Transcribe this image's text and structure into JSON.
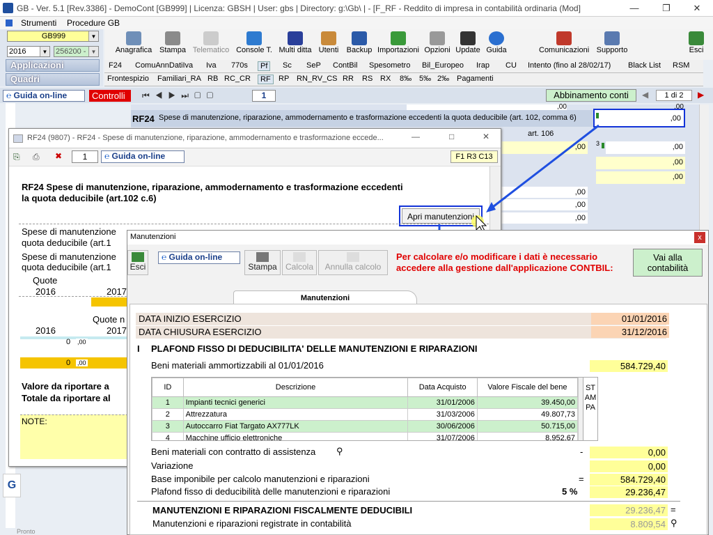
{
  "titlebar": {
    "title": "GB - Ver. 5.1 [Rev.3386] - DemoCont [GB999]   | Licenza: GBSH | User: gbs | Directory: g:\\Gb\\ | - [F_RF - Reddito di impresa in contabilità ordinaria (Mod]"
  },
  "menu": {
    "items": [
      "Strumenti",
      "Procedure GB"
    ]
  },
  "left": {
    "company": "GB999",
    "year": "2016",
    "code": "256200 -",
    "applicazioni": "Applicazioni",
    "quadri": "Quadri"
  },
  "toolbar": {
    "buttons": [
      "Anagrafica",
      "Stampa",
      "Telematico",
      "Console T.",
      "Multi ditta",
      "Utenti",
      "Backup",
      "Importazioni",
      "Opzioni",
      "Update",
      "Guida",
      "Comunicazioni",
      "Supporto",
      "Esci"
    ]
  },
  "tabs1": [
    "F24",
    "ComuAnnDatiIva",
    "Iva",
    "770s",
    "Pf",
    "Sc",
    "SeP",
    "ContBil",
    "Spesometro",
    "Bil_Europeo",
    "Irap",
    "CU",
    "Intento (fino al 28/02/17)",
    "Black List",
    "RSM"
  ],
  "tabs2": [
    "Frontespizio",
    "Familiari_RA",
    "RB",
    "RC_CR",
    "RF",
    "RP",
    "RN_RV_CS",
    "RR",
    "RS",
    "RX",
    "8‰",
    "5‰",
    "2‰",
    "Pagamenti"
  ],
  "navrow": {
    "guida": "Guida on-line",
    "controlli": "Controlli",
    "page": "1",
    "abbinamento": "Abbinamento conti",
    "page_of": "1 di 2"
  },
  "bg": {
    "rf24_code": "RF24",
    "rf24_desc": "Spese di manutenzione, riparazione, ammodernamento e trasformazione eccedenti la quota deducibile (art. 102, comma 6)",
    "rf24_val": ",00",
    "art106": "art. 106",
    "vals": [
      ",00",
      ",00",
      ",00",
      ",00",
      ",00",
      ",00",
      ",00"
    ],
    "small_nums": [
      "3",
      "2",
      "8"
    ],
    "top_vals": [
      ",00",
      ",00"
    ]
  },
  "win1": {
    "title": "RF24 (9807) - RF24 - Spese di manutenzione, riparazione, ammodernamento e trasformazione eccede...",
    "page": "1",
    "guida": "Guida on-line",
    "ref": "F1 R3 C13",
    "heading1": "RF24 Spese di manutenzione, riparazione, ammodernamento e trasformazione eccedenti",
    "heading2": "la quota deducibile (art.102 c.6)",
    "button": "Apri manutenzioni",
    "l1": "Spese di manutenzione",
    "l1b": "quota deducibile (art.1",
    "l2": "Spese di manutenzione",
    "l2b": "quota deducibile (art.1",
    "quote": "Quote",
    "y2016": "2016",
    "y2017": "2017",
    "quote2": "Quote n",
    "y2016b": "2016",
    "y2017b": "2017",
    "v0": "0",
    "v00": ",00",
    "v0b": "0",
    "v00b": ",00",
    "valore": "Valore da riportare a",
    "totale": "Totale da riportare al",
    "note": "NOTE:"
  },
  "win2": {
    "title": "Manutenzioni",
    "esci": "Esci",
    "guida": "Guida on-line",
    "stampa": "Stampa",
    "calcola": "Calcola",
    "annulla": "Annulla calcolo",
    "warn1": "Per calcolare e/o modificare i dati è necessario",
    "warn2": "accedere alla gestione dall'applicazione CONTBIL:",
    "vai": "Vai alla contabilità",
    "tab": "Manutenzioni",
    "inizio_l": "DATA INIZIO ESERCIZIO",
    "inizio_v": "01/01/2016",
    "chiusura_l": "DATA CHIUSURA ESERCIZIO",
    "chiusura_v": "31/12/2016",
    "sec1_n": "I",
    "sec1": "PLAFOND FISSO DI DEDUCIBILITA' DELLE MANUTENZIONI E  RIPARAZIONI",
    "beni_l": "Beni materiali ammortizzabili al 01/01/2016",
    "beni_v": "584.729,40",
    "table": {
      "headers": [
        "ID",
        "Descrizione",
        "Data Acquisto",
        "Valore Fiscale del bene"
      ],
      "rows": [
        {
          "id": "1",
          "desc": "Impianti tecnici generici",
          "data": "31/01/2006",
          "val": "39.450,00"
        },
        {
          "id": "2",
          "desc": "Attrezzatura",
          "data": "31/03/2006",
          "val": "49.807,73"
        },
        {
          "id": "3",
          "desc": "Autoccarro Fiat Targato AX777LK",
          "data": "30/06/2006",
          "val": "50.715,00"
        },
        {
          "id": "4",
          "desc": "Macchine ufficio elettroniche",
          "data": "31/07/2006",
          "val": "8.952,67"
        }
      ],
      "stampa": "STAMPA"
    },
    "assist_l": "Beni materiali con contratto di assistenza",
    "assist_op": "-",
    "assist_v": "0,00",
    "var_l": "Variazione",
    "var_v": "0,00",
    "base_l": "Base imponibile per calcolo manutenzioni e riparazioni",
    "base_op": "=",
    "base_v": "584.729,40",
    "plafond_l": "Plafond fisso di deducibilità delle manutenzioni e riparazioni",
    "plafond_pct": "5 %",
    "plafond_v": "29.236,47",
    "sec2": "MANUTENZIONI E RIPARAZIONI FISCALMENTE DEDUCIBILI",
    "sec2_v": "29.236,47",
    "sec2_op": "=",
    "reg_l": "Manutenzioni e riparazioni registrate in contabilità",
    "reg_v": "8.809,54"
  },
  "status": "Pronto"
}
